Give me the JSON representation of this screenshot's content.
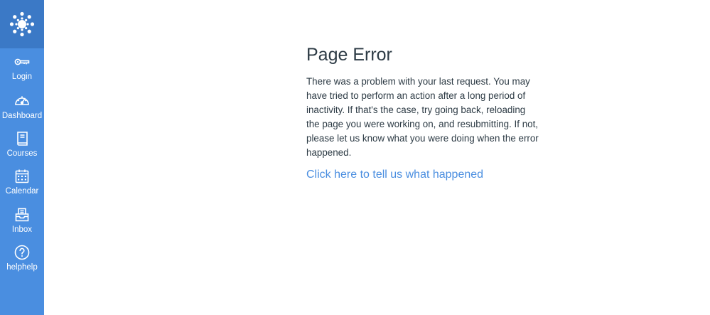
{
  "nav": {
    "items": [
      {
        "label": "Login",
        "icon": "key-icon"
      },
      {
        "label": "Dashboard",
        "icon": "gauge-icon"
      },
      {
        "label": "Courses",
        "icon": "book-icon"
      },
      {
        "label": "Calendar",
        "icon": "calendar-icon"
      },
      {
        "label": "Inbox",
        "icon": "inbox-icon"
      },
      {
        "label": "helphelp",
        "icon": "help-icon"
      }
    ]
  },
  "main": {
    "title": "Page Error",
    "message": "There was a problem with your last request. You may have tried to perform an action after a long period of inactivity. If that's the case, try going back, reloading the page you were working on, and resubmitting. If not, please let us know what you were doing when the error happened.",
    "report_link": "Click here to tell us what happened"
  },
  "colors": {
    "sidebar": "#4a8ee0",
    "logo_block": "#3b79c6",
    "link": "#4a8ee0",
    "text": "#2d3b45"
  }
}
